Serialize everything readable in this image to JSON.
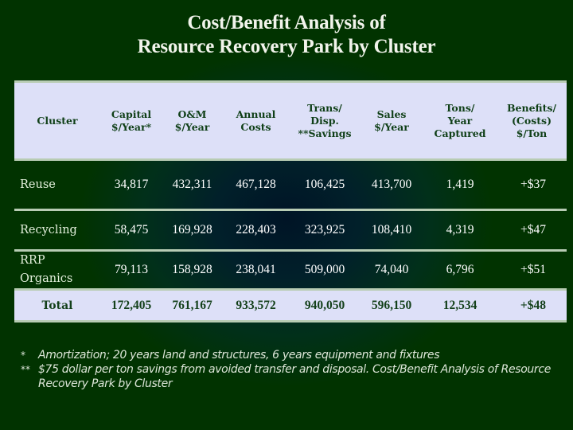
{
  "title": {
    "line1": "Cost/Benefit Analysis of",
    "line2": "Resource Recovery Park by Cluster"
  },
  "colors": {
    "background": "#013300",
    "header_fill": "#dde0f8",
    "border": "#b8ccb4",
    "header_text": "#0f3f17"
  },
  "table": {
    "headers": [
      {
        "lines": [
          "Cluster"
        ]
      },
      {
        "lines": [
          "Capital",
          "$/Year*"
        ]
      },
      {
        "lines": [
          "O&M",
          "$/Year"
        ]
      },
      {
        "lines": [
          "Annual",
          "Costs"
        ]
      },
      {
        "lines": [
          "Trans/",
          "Disp.",
          "**Savings"
        ]
      },
      {
        "lines": [
          "Sales",
          "$/Year"
        ]
      },
      {
        "lines": [
          "Tons/",
          "Year",
          "Captured"
        ]
      },
      {
        "lines": [
          "Benefits/",
          "(Costs)",
          "$/Ton"
        ]
      }
    ],
    "rows": [
      {
        "cluster": [
          "Reuse"
        ],
        "capital": "34,817",
        "om": "432,311",
        "annual": "467,128",
        "savings": "106,425",
        "sales": "413,700",
        "tons": "1,419",
        "benefit": "+$37"
      },
      {
        "cluster": [
          "Recycling"
        ],
        "capital": "58,475",
        "om": "169,928",
        "annual": "228,403",
        "savings": "323,925",
        "sales": "108,410",
        "tons": "4,319",
        "benefit": "+$47"
      },
      {
        "cluster": [
          "RRP",
          "Organics"
        ],
        "capital": "79,113",
        "om": "158,928",
        "annual": "238,041",
        "savings": "509,000",
        "sales": "74,040",
        "tons": "6,796",
        "benefit": "+$51"
      }
    ],
    "total": {
      "cluster": "Total",
      "capital": "172,405",
      "om": "761,167",
      "annual": "933,572",
      "savings": "940,050",
      "sales": "596,150",
      "tons": "12,534",
      "benefit": "+$48"
    }
  },
  "footnotes": [
    {
      "mark": "*",
      "text": "Amortization; 20 years land and structures, 6 years equipment and fixtures"
    },
    {
      "mark": "**",
      "text": "$75 dollar per ton savings from avoided transfer and disposal.   Cost/Benefit Analysis of Resource Recovery Park by Cluster"
    }
  ]
}
